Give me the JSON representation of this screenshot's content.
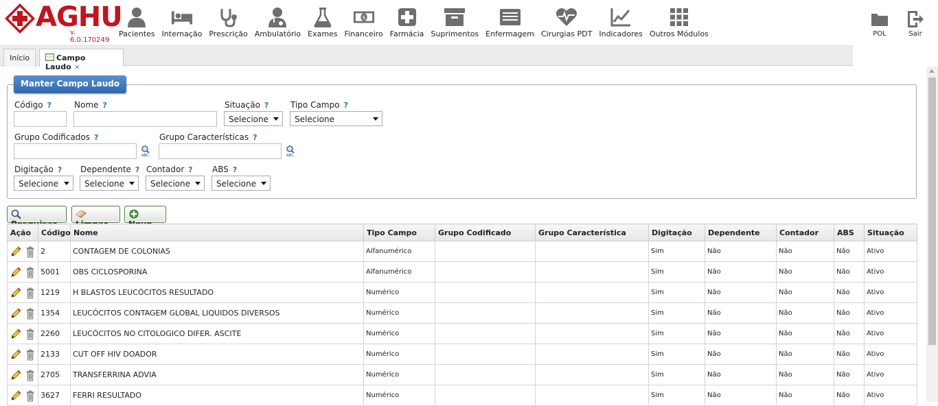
{
  "app": {
    "logo_text": "AGHU",
    "version": "v. 6.0.170249"
  },
  "colors": {
    "brand_red": "#c0161e",
    "legend_blue": "#2f66ad",
    "help_blue": "#2a6bc2"
  },
  "modules": [
    {
      "label": "Pacientes",
      "icon": "user-icon"
    },
    {
      "label": "Internação",
      "icon": "bed-icon"
    },
    {
      "label": "Prescrição",
      "icon": "stethoscope-icon"
    },
    {
      "label": "Ambulatório",
      "icon": "doctor-icon"
    },
    {
      "label": "Exames",
      "icon": "flask-icon"
    },
    {
      "label": "Financeiro",
      "icon": "money-icon"
    },
    {
      "label": "Farmácia",
      "icon": "plus-square-icon"
    },
    {
      "label": "Suprimentos",
      "icon": "archive-icon"
    },
    {
      "label": "Enfermagem",
      "icon": "list-icon"
    },
    {
      "label": "Cirurgias PDT",
      "icon": "heartbeat-icon"
    },
    {
      "label": "Indicadores",
      "icon": "line-chart-icon"
    },
    {
      "label": "Outros Módulos",
      "icon": "grid-icon"
    }
  ],
  "right_modules": [
    {
      "label": "POL",
      "icon": "folder-icon"
    },
    {
      "label": "Sair",
      "icon": "exit-icon"
    }
  ],
  "tabs": [
    {
      "label": "Início"
    },
    {
      "label": "Campo Laudo",
      "close": "×"
    }
  ],
  "form": {
    "legend": "Manter Campo Laudo",
    "help": "?",
    "codigo_label": "Código",
    "nome_label": "Nome",
    "situacao_label": "Situação",
    "situacao_value": "Selecione",
    "tipo_campo_label": "Tipo Campo",
    "tipo_campo_value": "Selecione",
    "grupo_codificados_label": "Grupo Codificados",
    "grupo_caracteristicas_label": "Grupo Características",
    "digitacao_label": "Digitação",
    "digitacao_value": "Selecione",
    "dependente_label": "Dependente",
    "dependente_value": "Selecione",
    "contador_label": "Contador",
    "contador_value": "Selecione",
    "abs_label": "ABS",
    "abs_value": "Selecione"
  },
  "buttons": {
    "pesquisar": "Pesquisar",
    "limpar": "Limpar",
    "novo": "Novo"
  },
  "table": {
    "headers": [
      "Ação",
      "Código",
      "Nome",
      "Tipo Campo",
      "Grupo Codificado",
      "Grupo Característica",
      "Digitação",
      "Dependente",
      "Contador",
      "ABS",
      "Situação"
    ],
    "rows": [
      {
        "codigo": "2",
        "nome": "CONTAGEM DE COLONIAS",
        "tipo": "Alfanumérico",
        "grupo_cod": "",
        "grupo_car": "",
        "digitacao": "Sim",
        "dependente": "Não",
        "contador": "Não",
        "abs": "Não",
        "situacao": "Ativo"
      },
      {
        "codigo": "5001",
        "nome": "OBS CICLOSPORINA",
        "tipo": "Alfanumérico",
        "grupo_cod": "",
        "grupo_car": "",
        "digitacao": "Sim",
        "dependente": "Não",
        "contador": "Não",
        "abs": "Não",
        "situacao": "Ativo"
      },
      {
        "codigo": "1219",
        "nome": "H BLASTOS LEUCÓCITOS RESULTADO",
        "tipo": "Numérico",
        "grupo_cod": "",
        "grupo_car": "",
        "digitacao": "Sim",
        "dependente": "Não",
        "contador": "Não",
        "abs": "Não",
        "situacao": "Ativo"
      },
      {
        "codigo": "1354",
        "nome": "LEUCÓCITOS CONTAGEM GLOBAL LIQUIDOS DIVERSOS",
        "tipo": "Numérico",
        "grupo_cod": "",
        "grupo_car": "",
        "digitacao": "Sim",
        "dependente": "Não",
        "contador": "Não",
        "abs": "Não",
        "situacao": "Ativo"
      },
      {
        "codigo": "2260",
        "nome": "LEUCÓCITOS NO CITOLOGICO DIFER. ASCITE",
        "tipo": "Numérico",
        "grupo_cod": "",
        "grupo_car": "",
        "digitacao": "Sim",
        "dependente": "Não",
        "contador": "Não",
        "abs": "Não",
        "situacao": "Ativo"
      },
      {
        "codigo": "2133",
        "nome": "CUT OFF HIV DOADOR",
        "tipo": "Numérico",
        "grupo_cod": "",
        "grupo_car": "",
        "digitacao": "Sim",
        "dependente": "Não",
        "contador": "Não",
        "abs": "Não",
        "situacao": "Ativo"
      },
      {
        "codigo": "2705",
        "nome": "TRANSFERRINA ADVIA",
        "tipo": "Numérico",
        "grupo_cod": "",
        "grupo_car": "",
        "digitacao": "Sim",
        "dependente": "Não",
        "contador": "Não",
        "abs": "Não",
        "situacao": "Ativo"
      },
      {
        "codigo": "3627",
        "nome": "FERRI RESULTADO",
        "tipo": "Numérico",
        "grupo_cod": "",
        "grupo_car": "",
        "digitacao": "Sim",
        "dependente": "Não",
        "contador": "Não",
        "abs": "Não",
        "situacao": "Ativo"
      }
    ]
  }
}
